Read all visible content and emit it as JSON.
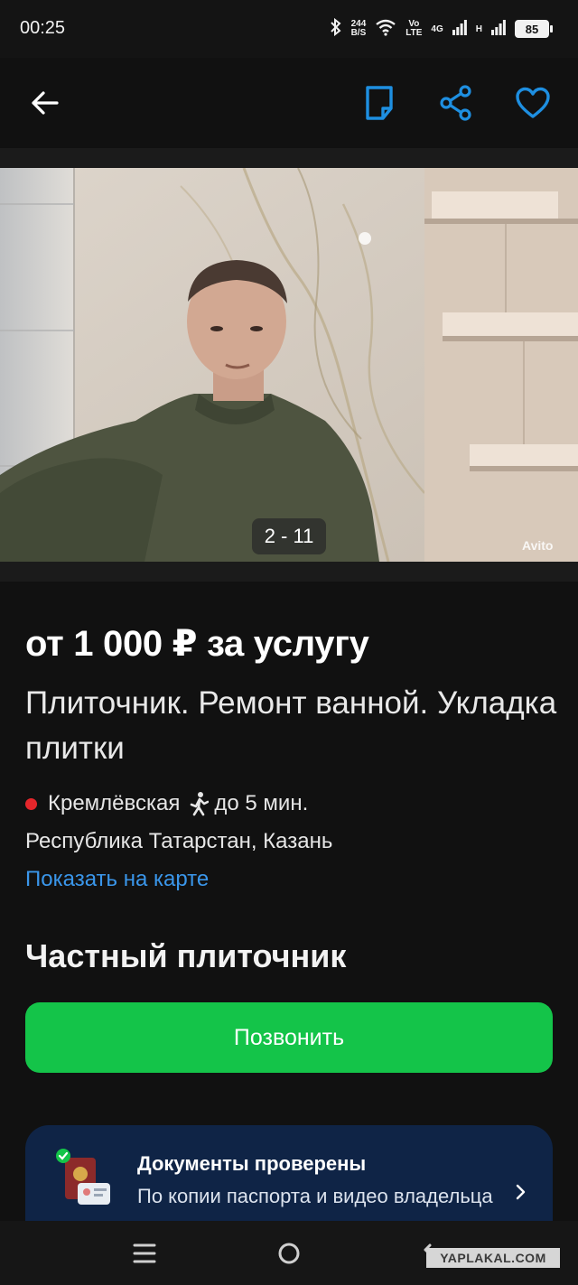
{
  "status_bar": {
    "time": "00:25",
    "speed_value": "244",
    "speed_unit": "B/S",
    "volte_top": "Vo",
    "volte_bottom": "LTE",
    "network_1": "4G",
    "network_2": "H",
    "battery": "85",
    "icons": [
      "bluetooth-icon",
      "wifi-icon",
      "signal-icon",
      "signal-icon",
      "battery-icon"
    ]
  },
  "header": {
    "icons": [
      "back-arrow-icon",
      "note-icon",
      "share-icon",
      "heart-icon"
    ],
    "accent": "#1e8fe1"
  },
  "gallery": {
    "counter": "2 - 11",
    "watermark": "Avito"
  },
  "listing": {
    "price": "от 1 000 ₽ за услугу",
    "title": "Плиточник. Ремонт ванной. Укладка плитки",
    "metro_station": "Кремлёвская",
    "metro_color": "#e5262b",
    "walk_time": "до 5 мин.",
    "region": "Республика Татарстан, Казань",
    "map_link": "Показать на карте"
  },
  "seller": {
    "name": "Частный плиточник",
    "call_button": "Позвонить",
    "call_color": "#14c449"
  },
  "docs_card": {
    "title": "Документы проверены",
    "subtitle": "По копии паспорта и видео владельца"
  },
  "bottom_watermark": "YAPLAKAL.COM"
}
